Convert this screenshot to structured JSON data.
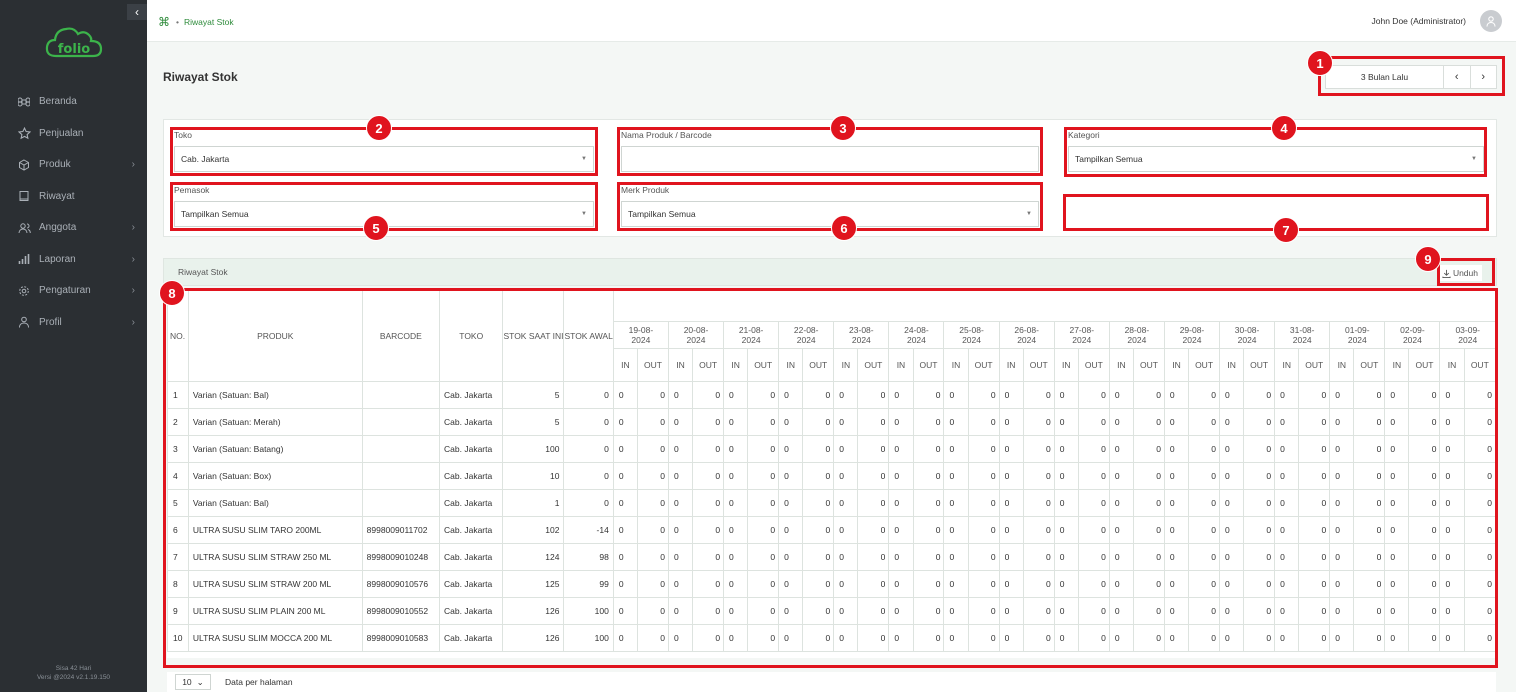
{
  "sidebar": {
    "logo_text": "folio",
    "items": [
      {
        "label": "Beranda",
        "icon": "command-icon",
        "has_children": false
      },
      {
        "label": "Penjualan",
        "icon": "star-icon",
        "has_children": false
      },
      {
        "label": "Produk",
        "icon": "box-icon",
        "has_children": true
      },
      {
        "label": "Riwayat",
        "icon": "book-icon",
        "has_children": false
      },
      {
        "label": "Anggota",
        "icon": "users-icon",
        "has_children": true
      },
      {
        "label": "Laporan",
        "icon": "bar-chart-icon",
        "has_children": true
      },
      {
        "label": "Pengaturan",
        "icon": "gear-icon",
        "has_children": true
      },
      {
        "label": "Profil",
        "icon": "user-icon",
        "has_children": true
      }
    ],
    "footer_line1": "Sisa 42 Hari",
    "footer_line2": "Versi @2024 v2.1.19.150"
  },
  "header": {
    "breadcrumb": "Riwayat Stok",
    "user": "John Doe (Administrator)"
  },
  "page": {
    "title": "Riwayat Stok",
    "period_label": "3 Bulan Lalu"
  },
  "filters": {
    "toko": {
      "label": "Toko",
      "value": "Cab. Jakarta"
    },
    "nama_produk": {
      "label": "Nama Produk / Barcode",
      "value": ""
    },
    "kategori": {
      "label": "Kategori",
      "value": "Tampilkan Semua"
    },
    "pemasok": {
      "label": "Pemasok",
      "value": "Tampilkan Semua"
    },
    "merk": {
      "label": "Merk Produk",
      "value": "Tampilkan Semua"
    }
  },
  "table_card": {
    "title": "Riwayat Stok",
    "download_label": "Unduh"
  },
  "table": {
    "headers": {
      "no": "NO.",
      "produk": "PRODUK",
      "barcode": "BARCODE",
      "toko": "TOKO",
      "stok_saat_ini": "STOK SAAT INI",
      "stok_awal": "STOK AWAL",
      "in": "IN",
      "out": "OUT"
    },
    "dates": [
      "19-08-2024",
      "20-08-2024",
      "21-08-2024",
      "22-08-2024",
      "23-08-2024",
      "24-08-2024",
      "25-08-2024",
      "26-08-2024",
      "27-08-2024",
      "28-08-2024",
      "29-08-2024",
      "30-08-2024",
      "31-08-2024",
      "01-09-2024",
      "02-09-2024",
      "03-09-2024"
    ],
    "rows": [
      {
        "no": "1",
        "produk": "Varian (Satuan: Bal)",
        "barcode": "",
        "toko": "Cab. Jakarta",
        "stok_saat_ini": "5",
        "stok_awal": "0"
      },
      {
        "no": "2",
        "produk": "Varian (Satuan: Merah)",
        "barcode": "",
        "toko": "Cab. Jakarta",
        "stok_saat_ini": "5",
        "stok_awal": "0"
      },
      {
        "no": "3",
        "produk": "Varian (Satuan: Batang)",
        "barcode": "",
        "toko": "Cab. Jakarta",
        "stok_saat_ini": "100",
        "stok_awal": "0"
      },
      {
        "no": "4",
        "produk": "Varian (Satuan: Box)",
        "barcode": "",
        "toko": "Cab. Jakarta",
        "stok_saat_ini": "10",
        "stok_awal": "0"
      },
      {
        "no": "5",
        "produk": "Varian (Satuan: Bal)",
        "barcode": "",
        "toko": "Cab. Jakarta",
        "stok_saat_ini": "1",
        "stok_awal": "0"
      },
      {
        "no": "6",
        "produk": "ULTRA SUSU SLIM TARO 200ML",
        "barcode": "8998009011702",
        "toko": "Cab. Jakarta",
        "stok_saat_ini": "102",
        "stok_awal": "-14"
      },
      {
        "no": "7",
        "produk": "ULTRA SUSU SLIM STRAW 250 ML",
        "barcode": "8998009010248",
        "toko": "Cab. Jakarta",
        "stok_saat_ini": "124",
        "stok_awal": "98"
      },
      {
        "no": "8",
        "produk": "ULTRA SUSU SLIM STRAW 200 ML",
        "barcode": "8998009010576",
        "toko": "Cab. Jakarta",
        "stok_saat_ini": "125",
        "stok_awal": "99"
      },
      {
        "no": "9",
        "produk": "ULTRA SUSU SLIM PLAIN 200 ML",
        "barcode": "8998009010552",
        "toko": "Cab. Jakarta",
        "stok_saat_ini": "126",
        "stok_awal": "100"
      },
      {
        "no": "10",
        "produk": "ULTRA SUSU SLIM MOCCA 200 ML",
        "barcode": "8998009010583",
        "toko": "Cab. Jakarta",
        "stok_saat_ini": "126",
        "stok_awal": "100"
      }
    ],
    "movement_value": "0"
  },
  "pagination": {
    "page_size": "10",
    "label": "Data per halaman"
  },
  "annotations": [
    "1",
    "2",
    "3",
    "4",
    "5",
    "6",
    "7",
    "8",
    "9"
  ],
  "colors": {
    "sidebar_bg": "#2b2f33",
    "accent_green": "#2e8b3b",
    "annotation_red": "#e0141e"
  }
}
